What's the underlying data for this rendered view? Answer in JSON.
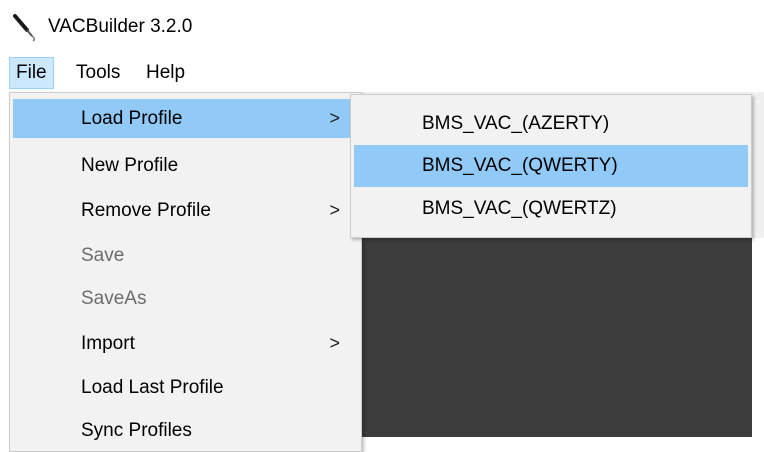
{
  "window": {
    "title": "VACBuilder 3.2.0",
    "icon": "microphone-icon"
  },
  "menubar": {
    "items": [
      {
        "label": "File"
      },
      {
        "label": "Tools"
      },
      {
        "label": "Help"
      }
    ],
    "open_menu": "File"
  },
  "file_menu": {
    "items": [
      {
        "label": "Load Profile",
        "submenu": true,
        "enabled": true,
        "highlighted": true
      },
      {
        "label": "New Profile",
        "submenu": false,
        "enabled": true
      },
      {
        "label": "Remove Profile",
        "submenu": true,
        "enabled": true
      },
      {
        "label": "Save",
        "submenu": false,
        "enabled": false
      },
      {
        "label": "SaveAs",
        "submenu": false,
        "enabled": false
      },
      {
        "label": "Import",
        "submenu": true,
        "enabled": true
      },
      {
        "label": "Load Last Profile",
        "submenu": false,
        "enabled": true
      },
      {
        "label": "Sync Profiles",
        "submenu": false,
        "enabled": true
      }
    ],
    "submenu_arrow": ">"
  },
  "load_profile_submenu": {
    "items": [
      {
        "label": "BMS_VAC_(AZERTY)",
        "highlighted": false
      },
      {
        "label": "BMS_VAC_(QWERTY)",
        "highlighted": true
      },
      {
        "label": "BMS_VAC_(QWERTZ)",
        "highlighted": false
      }
    ]
  },
  "colors": {
    "menu_background": "#f2f2f2",
    "highlight": "#91c9f7",
    "menubar_open": "#cce8ff",
    "disabled_text": "#6d6d6d",
    "content_dark": "#3c3c3c"
  }
}
